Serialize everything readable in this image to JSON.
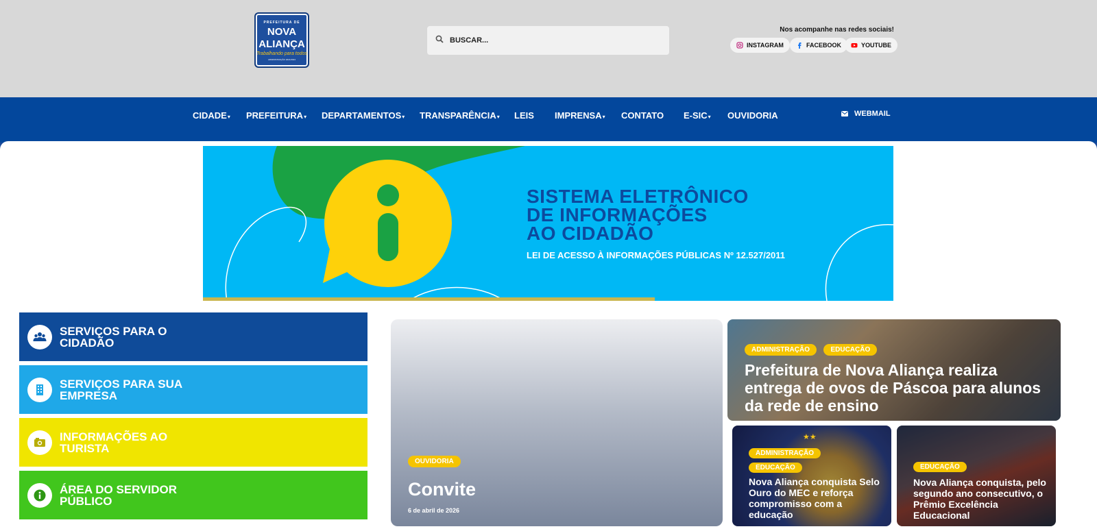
{
  "header": {
    "logo": {
      "line1": "PREFEITURA DE",
      "line2": "NOVA",
      "line3": "ALIANÇA",
      "tagline": "Trabalhando para todos",
      "small": "ADMINISTRAÇÃO 2021/2024"
    },
    "search": {
      "placeholder": "BUSCAR..."
    },
    "social": {
      "title": "Nos acompanhe nas redes sociais!",
      "links": [
        {
          "label": "INSTAGRAM",
          "icon": "instagram-icon",
          "color": "#c13584"
        },
        {
          "label": "FACEBOOK",
          "icon": "facebook-icon",
          "color": "#1877f2"
        },
        {
          "label": "YOUTUBE",
          "icon": "youtube-icon",
          "color": "#ff0000"
        }
      ]
    }
  },
  "nav": {
    "items": [
      {
        "label": "CIDADE",
        "dropdown": true
      },
      {
        "label": "PREFEITURA",
        "dropdown": true
      },
      {
        "label": "DEPARTAMENTOS",
        "dropdown": true
      },
      {
        "label": "TRANSPARÊNCIA",
        "dropdown": true
      },
      {
        "label": "LEIS",
        "dropdown": false
      },
      {
        "label": "IMPRENSA",
        "dropdown": true
      },
      {
        "label": "CONTATO",
        "dropdown": false
      },
      {
        "label": "E-SIC",
        "dropdown": true
      },
      {
        "label": "OUVIDORIA",
        "dropdown": false
      }
    ],
    "webmail": "WEBMAIL"
  },
  "banner": {
    "line1": "SISTEMA ELETRÔNICO",
    "line2": "DE INFORMAÇÕES",
    "line3": "AO CIDADÃO",
    "law": "LEI DE ACESSO À INFORMAÇÕES PÚBLICAS Nº 12.527/2011"
  },
  "services": [
    {
      "label": "SERVIÇOS PARA O CIDADÃO",
      "color": "#0f4b99",
      "icon": "people-icon"
    },
    {
      "label": "SERVIÇOS PARA SUA EMPRESA",
      "color": "#1fa8e8",
      "icon": "building-icon"
    },
    {
      "label": "INFORMAÇÕES AO TURISTA",
      "color": "#f0e500",
      "icon": "camera-icon"
    },
    {
      "label": "ÁREA DO SERVIDOR PÚBLICO",
      "color": "#41c61d",
      "icon": "info-icon"
    }
  ],
  "news": {
    "featured": {
      "tag": "OUVIDORIA",
      "title": "Convite",
      "date": "6 de abril de 2026"
    },
    "top": {
      "tags": [
        "ADMINISTRAÇÃO",
        "EDUCAÇÃO"
      ],
      "title": "Prefeitura de Nova Aliança realiza entrega de ovos de Páscoa para alunos da rede de ensino"
    },
    "bottom_left": {
      "tags": [
        "ADMINISTRAÇÃO",
        "EDUCAÇÃO"
      ],
      "title": "Nova Aliança conquista Selo Ouro do MEC e reforça compromisso com a educação"
    },
    "bottom_right": {
      "tags": [
        "EDUCAÇÃO"
      ],
      "title": "Nova Aliança conquista, pelo segundo ano consecutivo, o Prêmio Excelência Educacional"
    }
  }
}
